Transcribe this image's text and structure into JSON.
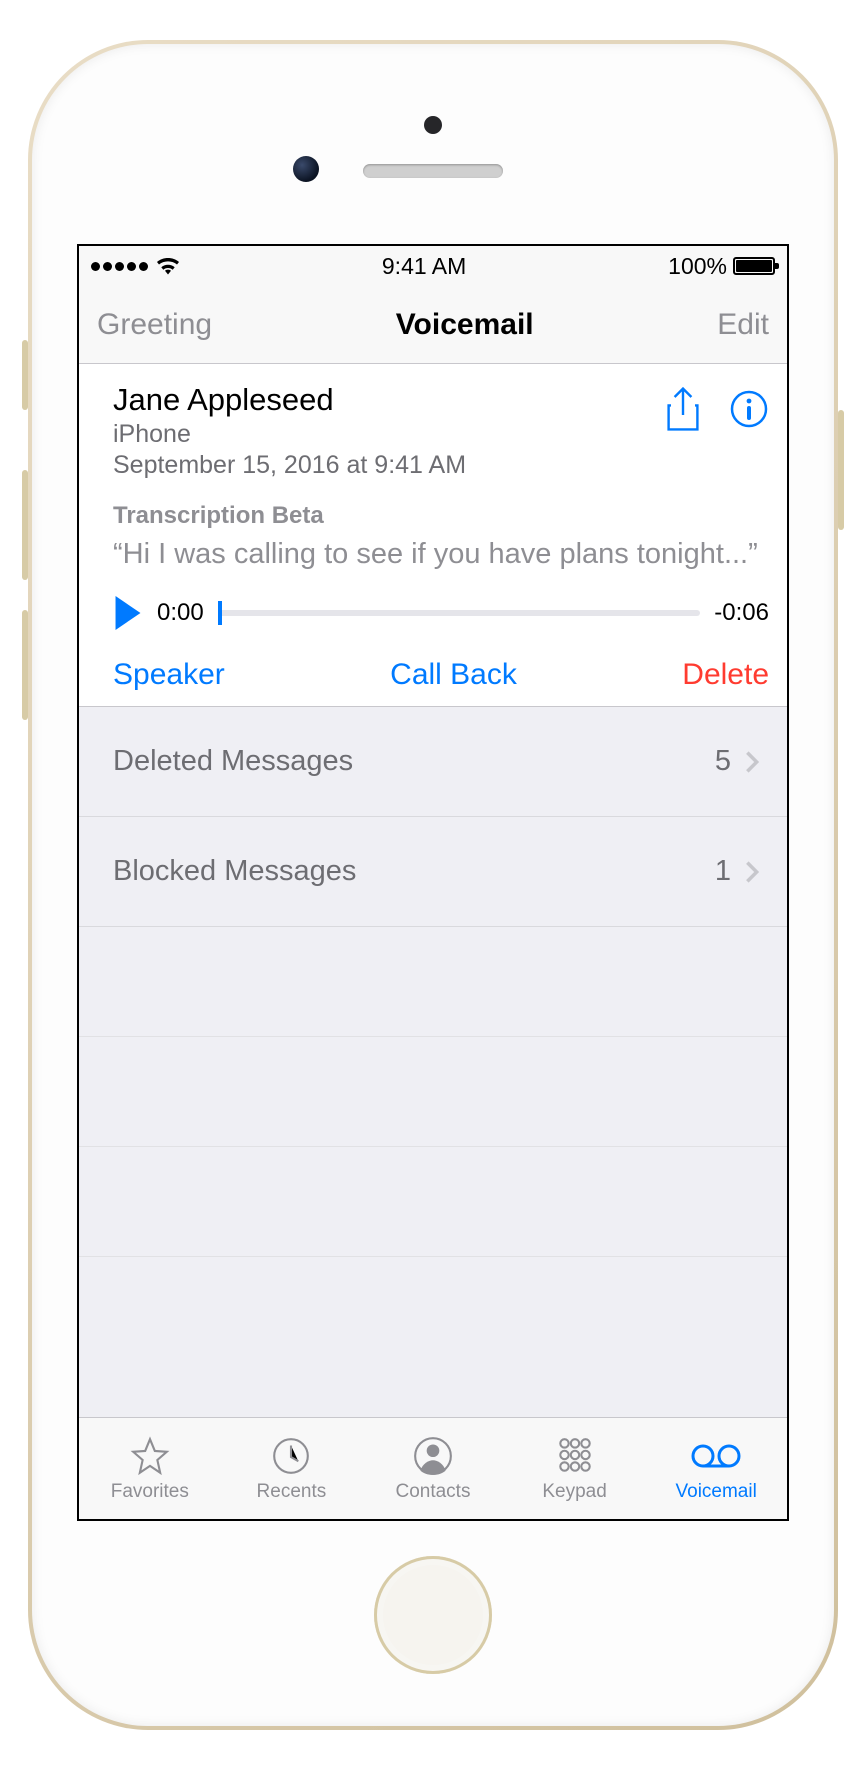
{
  "statusbar": {
    "time": "9:41 AM",
    "battery_pct": "100%"
  },
  "navbar": {
    "left": "Greeting",
    "title": "Voicemail",
    "right": "Edit"
  },
  "voicemail": {
    "name": "Jane Appleseed",
    "device": "iPhone",
    "date": "September 15, 2016 at 9:41 AM",
    "transcription_label": "Transcription Beta",
    "transcription_text": "“Hi I was calling to see if you have plans tonight...”",
    "current_time": "0:00",
    "duration": "-0:06",
    "controls": {
      "speaker": "Speaker",
      "callback": "Call Back",
      "delete": "Delete"
    }
  },
  "list": {
    "rows": [
      {
        "label": "Deleted Messages",
        "count": "5"
      },
      {
        "label": "Blocked Messages",
        "count": "1"
      }
    ]
  },
  "tabs": {
    "favorites": "Favorites",
    "recents": "Recents",
    "contacts": "Contacts",
    "keypad": "Keypad",
    "voicemail": "Voicemail"
  },
  "colors": {
    "accent": "#007aff",
    "destructive": "#ff3b30",
    "gray": "#8e8e93"
  }
}
